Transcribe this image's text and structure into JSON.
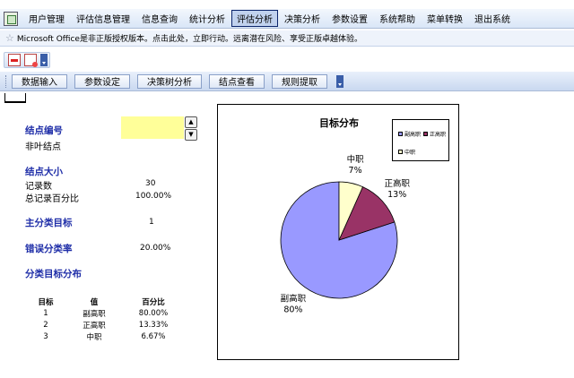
{
  "menu": {
    "items": [
      "用户管理",
      "评估信息管理",
      "信息查询",
      "统计分析",
      "评估分析",
      "决策分析",
      "参数设置",
      "系统帮助",
      "菜单转换",
      "退出系统"
    ],
    "active_index": 4
  },
  "infobar": {
    "text": "Microsoft Office是非正版授权版本。点击此处，立即行动。远离潜在风险、享受正版卓越体验。"
  },
  "toolbar": {
    "buttons": [
      "数据输入",
      "参数设定",
      "决策树分析",
      "结点查看",
      "规则提取"
    ]
  },
  "node": {
    "number_label": "结点编号",
    "number_value": "",
    "type_text": "非叶结点",
    "size_label": "结点大小",
    "record_count_label": "记录数",
    "record_count_value": "30",
    "record_pct_label": "总记录百分比",
    "record_pct_value": "100.00%",
    "main_target_label": "主分类目标",
    "main_target_value": "1",
    "error_rate_label": "错误分类率",
    "error_rate_value": "20.00%",
    "dist_label": "分类目标分布",
    "dist_headers": [
      "目标",
      "值",
      "百分比"
    ],
    "dist_rows": [
      {
        "target": "1",
        "value": "副高职",
        "pct": "80.00%"
      },
      {
        "target": "2",
        "value": "正高职",
        "pct": "13.33%"
      },
      {
        "target": "3",
        "value": "中职",
        "pct": "6.67%"
      }
    ]
  },
  "chart_data": {
    "type": "pie",
    "title": "目标分布",
    "legend_position": "top-right",
    "slices": [
      {
        "label": "副高职",
        "pct_label": "80%",
        "value": 80,
        "color": "#9999ff"
      },
      {
        "label": "正高职",
        "pct_label": "13%",
        "value": 13.33,
        "color": "#993366"
      },
      {
        "label": "中职",
        "pct_label": "7%",
        "value": 6.67,
        "color": "#ffffcc"
      }
    ],
    "legend": [
      "副高职",
      "正高职",
      "中职"
    ]
  }
}
